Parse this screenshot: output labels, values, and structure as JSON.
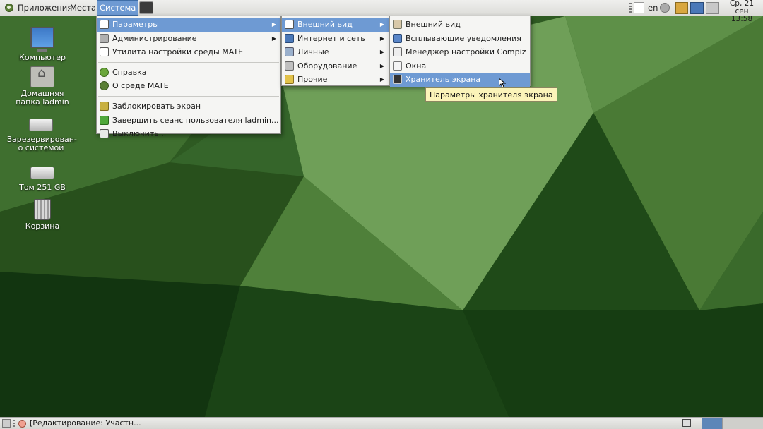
{
  "top_panel": {
    "applications": "Приложения",
    "places": "Места",
    "system": "Система",
    "keyboard_layout": "en",
    "date": "Ср, 21 сен",
    "time": "13:58"
  },
  "desktop_icons": [
    {
      "label": "Компьютер",
      "icon": "computer-icon"
    },
    {
      "label": "Домашняя папка ladmin",
      "icon": "home-folder-icon"
    },
    {
      "label": "Зарезервирован­о системой",
      "icon": "drive-icon"
    },
    {
      "label": "Том 251 GB",
      "icon": "drive-icon"
    },
    {
      "label": "Корзина",
      "icon": "trash-icon"
    }
  ],
  "system_menu": {
    "items": [
      {
        "label": "Параметры",
        "submenu": true
      },
      {
        "label": "Администрирование",
        "submenu": true
      },
      {
        "label": "Утилита настройки среды MATE"
      },
      {
        "label": "Справка"
      },
      {
        "label": "О среде MATE"
      },
      {
        "label": "Заблокировать экран"
      },
      {
        "label": "Завершить сеанс пользователя ladmin..."
      },
      {
        "label": "Выключить..."
      }
    ]
  },
  "params_menu": {
    "items": [
      {
        "label": "Внешний вид",
        "submenu": true
      },
      {
        "label": "Интернет и сеть",
        "submenu": true
      },
      {
        "label": "Личные",
        "submenu": true
      },
      {
        "label": "Оборудование",
        "submenu": true
      },
      {
        "label": "Прочие",
        "submenu": true
      }
    ]
  },
  "appearance_menu": {
    "items": [
      {
        "label": "Внешний вид"
      },
      {
        "label": "Всплывающие уведомления"
      },
      {
        "label": "Менеджер настройки Compiz"
      },
      {
        "label": "Окна"
      },
      {
        "label": "Хранитель экрана"
      }
    ]
  },
  "tooltip": "Параметры хранителя экрана",
  "taskbar": {
    "window_title": "[Редактирование: Участн..."
  },
  "colors": {
    "highlight": "#6e9ad3",
    "tooltip_bg": "#fbf4b9"
  }
}
